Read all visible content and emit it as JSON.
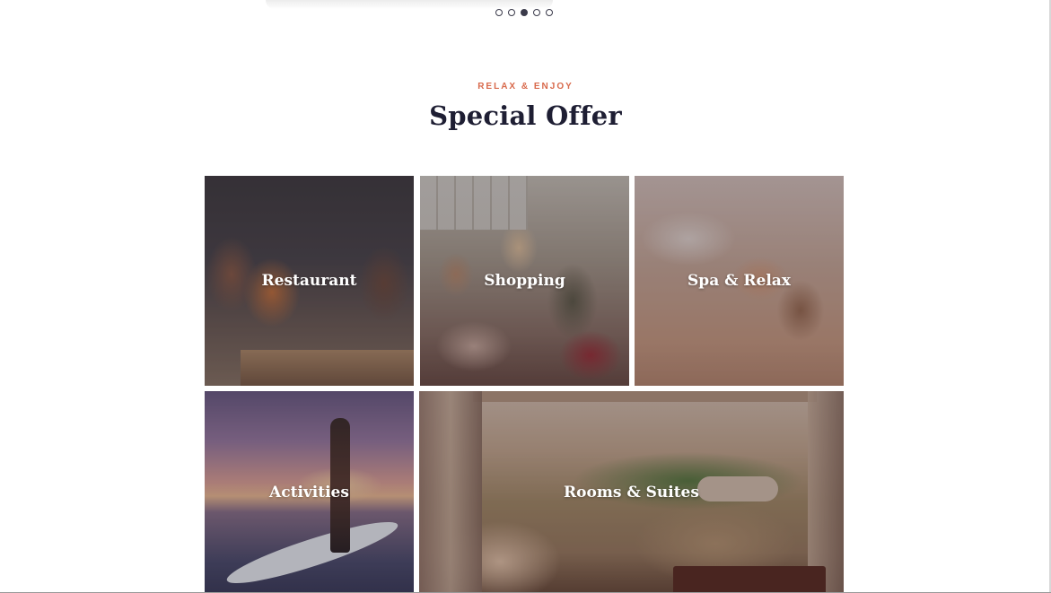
{
  "carousel": {
    "dots": [
      {
        "label": "slide-1",
        "active": false
      },
      {
        "label": "slide-2",
        "active": false
      },
      {
        "label": "slide-3",
        "active": true
      },
      {
        "label": "slide-4",
        "active": false
      },
      {
        "label": "slide-5",
        "active": false
      }
    ]
  },
  "section": {
    "eyebrow": "RELAX & ENJOY",
    "title": "Special Offer"
  },
  "offers": [
    {
      "label": "Restaurant"
    },
    {
      "label": "Shopping"
    },
    {
      "label": "Spa & Relax"
    },
    {
      "label": "Activities"
    },
    {
      "label": "Rooms & Suites"
    }
  ],
  "colors": {
    "accent": "#d8694b",
    "heading": "#1e1e33",
    "background": "#ffffff"
  }
}
